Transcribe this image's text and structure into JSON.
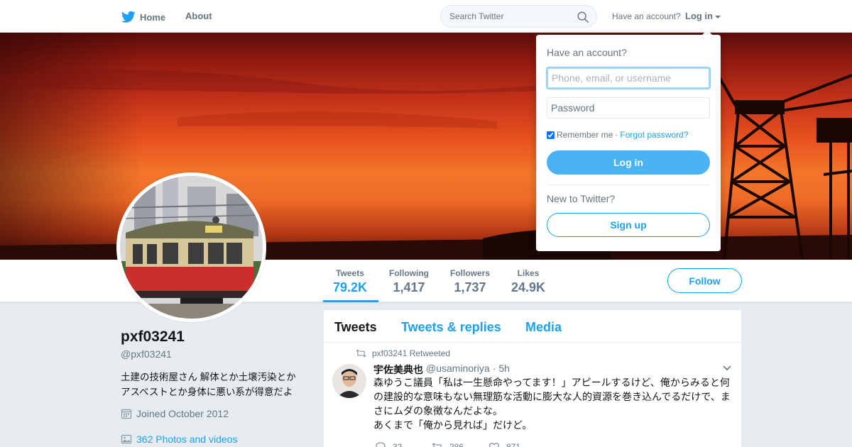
{
  "nav": {
    "home_label": "Home",
    "about_label": "About",
    "search_placeholder": "Search Twitter",
    "have_account": "Have an account?",
    "login_label": "Log in"
  },
  "stats": {
    "tweets": {
      "label": "Tweets",
      "value": "79.2K"
    },
    "following": {
      "label": "Following",
      "value": "1,417"
    },
    "followers": {
      "label": "Followers",
      "value": "1,737"
    },
    "likes": {
      "label": "Likes",
      "value": "24.9K"
    }
  },
  "follow_label": "Follow",
  "profile": {
    "name": "pxf03241",
    "handle": "@pxf03241",
    "bio_line1": "土建の技術屋さん 解体とか土壌汚染とか",
    "bio_line2": "アスベストとか身体に悪い系が得意だよ",
    "joined": "Joined October 2012",
    "photos": "362 Photos and videos"
  },
  "timeline": {
    "tabs": [
      "Tweets",
      "Tweets & replies",
      "Media"
    ]
  },
  "tweet": {
    "retweet_note": "pxf03241 Retweeted",
    "author_name": "宇佐美典也",
    "author_handle": "@usaminoriya",
    "dot": "·",
    "time": "5h",
    "text_line1": "森ゆうこ議員「私は一生懸命やってます！」アピールするけど、俺からみると何",
    "text_line2": "の建設的な意味もない無理筋な活動に膨大な人的資源を巻き込んでるだけで、ま",
    "text_line3": "さにムダの象徴なんだよな。",
    "text_line4": "あくまで「俺から見れば」だけど。",
    "replies": "32",
    "retweets": "286",
    "likes": "871"
  },
  "login_dropdown": {
    "title": "Have an account?",
    "username_placeholder": "Phone, email, or username",
    "password_placeholder": "Password",
    "remember_me": "Remember me",
    "separator": "·",
    "forgot_password": "Forgot password?",
    "login_button": "Log in",
    "new_to_twitter": "New to Twitter?",
    "signup_button": "Sign up"
  },
  "colors": {
    "accent": "#1da1f2",
    "login_button_bg": "#4ab3f4",
    "text_secondary": "#657786"
  }
}
